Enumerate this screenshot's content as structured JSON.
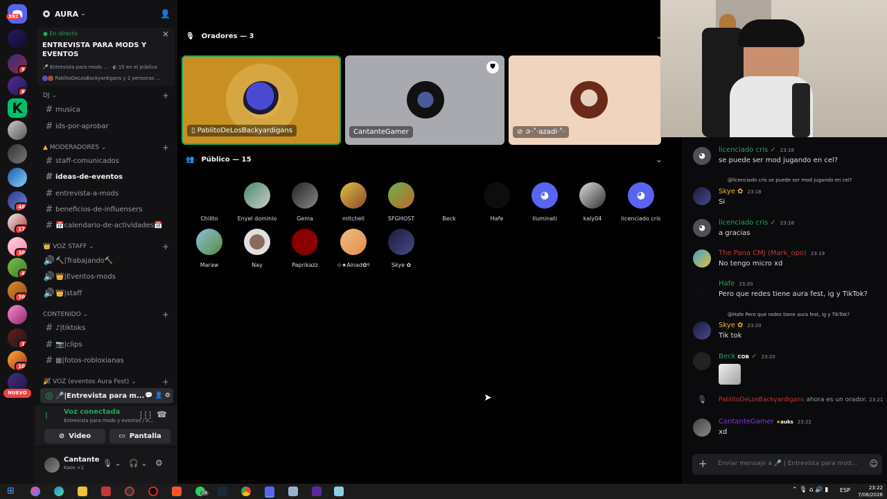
{
  "rail": {
    "badge_top": "392",
    "nuevo": "NUEVO",
    "badges": [
      "5",
      "6",
      "46",
      "17",
      "30",
      "4",
      "70",
      "1",
      "10"
    ]
  },
  "guild": {
    "name": "AURA"
  },
  "event": {
    "live": "En directo",
    "title": "ENTREVISTA PARA MODS Y EVENTOS",
    "sub1": "Entrevista para mods ...",
    "sub1b": "15 en el público",
    "sub2": "PablitoDeLosBackyardigans y 2 personas ..."
  },
  "sidebar": {
    "cat_dj": "DJ",
    "ch_musica": "musica",
    "ch_ids": "ids-por-aprobar",
    "cat_mod": "MODERADORES",
    "ch_staff": "staff-comunicados",
    "ch_ideas": "ideas-de-eventos",
    "ch_entrevista": "entrevista-a-mods",
    "ch_beneficios": "beneficios-de-influensers",
    "ch_calendario": "calendario-de-actividades",
    "cat_voz": "VOZ STAFF",
    "ch_trabajando": "Trabajando",
    "ch_eventos": "Eventos-mods",
    "ch_staffv": "staff",
    "cat_contenido": "CONTENIDO",
    "ch_tiktoks": "tiktoks",
    "ch_clips": "clips",
    "ch_fotos": "fotos-robloxianas",
    "cat_vozaura": "VOZ (eventos Aura Fest)",
    "ch_entrevistav": "Entrevista para m..."
  },
  "voice": {
    "connected": "Voz conectada",
    "channel": "Entrevista para mods y eventos / A...",
    "video": "Video",
    "screen": "Pantalla"
  },
  "user": {
    "name": "Cantante",
    "status": "Kaos +1"
  },
  "stage": {
    "speakers_header": "Oradores — 3",
    "speakers": [
      "PablitoDeLosBackyardigans",
      "CantanteGamer",
      "✰·˚·azadi·˚·"
    ],
    "audience_header": "Público — 15",
    "audience": [
      "Chilito",
      "Enyel dominio",
      "Gema",
      "mitchell",
      "SFGHOST",
      "Beck",
      "Hafe",
      "Iluminati",
      "kaly04",
      "licenciado cris",
      "Maraw",
      "Nay",
      "Paprikazz",
      "⊹★Ainad✿୨",
      "Skye ✿"
    ]
  },
  "chat": {
    "m1_author": "licenciado cris",
    "m1_time": "23:18",
    "m1_text": "se puede ser mod jugando en cel?",
    "m2_reply": "@licenciado cris se puede ser mod jugando en cel?",
    "m2_author": "Skye ✿",
    "m2_time": "23:18",
    "m2_text": "Si",
    "m3_author": "licenciado cris",
    "m3_time": "23:18",
    "m3_text": "a gracias",
    "m4_author": "The Pana CMJ (Mark_opo)",
    "m4_time": "23:19",
    "m4_text": "No tengo micro xd",
    "m5_author": "Hafe",
    "m5_time": "23:20",
    "m5_text": "Pero que redes tiene aura fest, ig y TikTok?",
    "m6_reply": "@Hafe Pero que redes tiene aura fest, ig y TikTok?",
    "m6_author": "Skye ✿",
    "m6_time": "23:20",
    "m6_text": "Tik tok",
    "m7_author": "Beck",
    "m7_tag": "COB",
    "m7_time": "23:20",
    "m8_user": "PablitoDeLosBackyardigans",
    "m8_text": "ahora es un orador.",
    "m8_time": "23:21",
    "m9_author": "CantanteGamer",
    "m9_tag": "auks",
    "m9_time": "23:22",
    "m9_text": "xd",
    "placeholder": "Enviar mensaje a 🎤 | Entrevista para mod..."
  },
  "taskbar": {
    "lang": "ESP",
    "time": "23:22",
    "date": "7/08/2026",
    "badge": "28"
  }
}
